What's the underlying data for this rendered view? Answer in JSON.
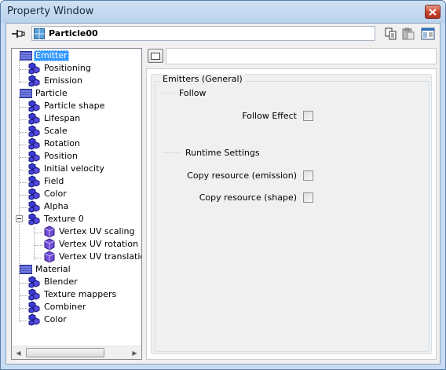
{
  "window": {
    "title": "Property Window",
    "close_icon": "close-icon"
  },
  "toolbar": {
    "object_name": "Particle00",
    "pin_icon": "pin-icon",
    "object_icon": "grid-object-icon",
    "copy_icon": "copy-icon",
    "paste_icon": "paste-icon",
    "window_icon": "window-layout-icon"
  },
  "tree": {
    "items": [
      {
        "label": "Emitter",
        "level": 0,
        "selected": true,
        "icon": "emitter-icon"
      },
      {
        "label": "Positioning",
        "level": 1,
        "icon": "node-icon"
      },
      {
        "label": "Emission",
        "level": 1,
        "icon": "node-icon"
      },
      {
        "label": "Particle",
        "level": 0,
        "icon": "particle-icon"
      },
      {
        "label": "Particle shape",
        "level": 1,
        "icon": "node-icon"
      },
      {
        "label": "Lifespan",
        "level": 1,
        "icon": "node-icon"
      },
      {
        "label": "Scale",
        "level": 1,
        "icon": "node-icon"
      },
      {
        "label": "Rotation",
        "level": 1,
        "icon": "node-icon"
      },
      {
        "label": "Position",
        "level": 1,
        "icon": "node-icon"
      },
      {
        "label": "Initial velocity",
        "level": 1,
        "icon": "node-icon"
      },
      {
        "label": "Field",
        "level": 1,
        "icon": "node-icon"
      },
      {
        "label": "Color",
        "level": 1,
        "icon": "node-icon"
      },
      {
        "label": "Alpha",
        "level": 1,
        "icon": "node-icon"
      },
      {
        "label": "Texture 0",
        "level": 1,
        "icon": "node-icon",
        "expanded": true
      },
      {
        "label": "Vertex UV scaling",
        "level": 2,
        "icon": "node-icon"
      },
      {
        "label": "Vertex UV rotation",
        "level": 2,
        "icon": "node-icon"
      },
      {
        "label": "Vertex UV translation",
        "level": 2,
        "icon": "node-icon"
      },
      {
        "label": "Material",
        "level": 0,
        "icon": "material-icon"
      },
      {
        "label": "Blender",
        "level": 1,
        "icon": "node-icon"
      },
      {
        "label": "Texture mappers",
        "level": 1,
        "icon": "node-icon"
      },
      {
        "label": "Combiner",
        "level": 1,
        "icon": "node-icon"
      },
      {
        "label": "Color",
        "level": 1,
        "icon": "node-icon"
      }
    ]
  },
  "panel": {
    "group_title": "Emitters (General)",
    "section_follow": "Follow",
    "follow_effect_label": "Follow Effect",
    "section_runtime": "Runtime Settings",
    "copy_emission_label": "Copy resource (emission)",
    "copy_shape_label": "Copy resource (shape)",
    "follow_effect_checked": false,
    "copy_emission_checked": false,
    "copy_shape_checked": false
  }
}
